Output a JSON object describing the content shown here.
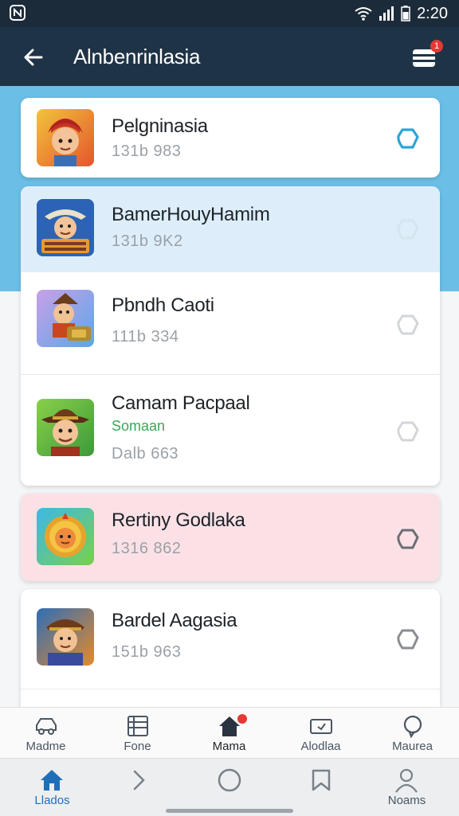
{
  "status_bar": {
    "time": "2:20"
  },
  "app_bar": {
    "title": "Alnbenrinlasia",
    "cart_badge": "1"
  },
  "items": [
    {
      "title": "Pelgninasia",
      "subtitle": "131b 983",
      "tag": "",
      "theme": "white",
      "selected": true
    },
    {
      "title": "BamerHouyHamim",
      "subtitle": "131b 9K2",
      "tag": "",
      "theme": "lightblue",
      "selected": false
    },
    {
      "title": "Pbndh Caoti",
      "subtitle": "111b 334",
      "tag": "",
      "theme": "white",
      "selected": false
    },
    {
      "title": "Camam Pacpaal",
      "subtitle": "Dalb 663",
      "tag": "Somaan",
      "theme": "white",
      "selected": false
    },
    {
      "title": "Rertiny Godlaka",
      "subtitle": "1316 862",
      "tag": "",
      "theme": "pink",
      "selected": false
    },
    {
      "title": "Bardel Aagasia",
      "subtitle": "151b 963",
      "tag": "",
      "theme": "white",
      "selected": false
    }
  ],
  "tab_bar": [
    {
      "label": "Madme",
      "icon": "car-icon"
    },
    {
      "label": "Fone",
      "icon": "list-icon"
    },
    {
      "label": "Mama",
      "icon": "home-icon",
      "badge": true
    },
    {
      "label": "Alodlaa",
      "icon": "ticket-icon"
    },
    {
      "label": "Maurea",
      "icon": "chat-icon"
    }
  ],
  "nav_bar": [
    {
      "label": "Llados",
      "icon": "home-icon",
      "active": true
    },
    {
      "label": "",
      "icon": "chevron-right-icon"
    },
    {
      "label": "",
      "icon": "circle-icon"
    },
    {
      "label": "",
      "icon": "bookmark-icon"
    },
    {
      "label": "Noams",
      "icon": "person-icon"
    }
  ],
  "colors": {
    "status_bar": "#1c2b3a",
    "app_bar": "#1f3347",
    "hero": "#6bbfe6",
    "selected_check": "#2ea3d6",
    "row_lightblue": "#ddeefa",
    "row_pink": "#fbe1e6",
    "tag_green": "#3aa856",
    "nav_active": "#1f6fb8"
  }
}
